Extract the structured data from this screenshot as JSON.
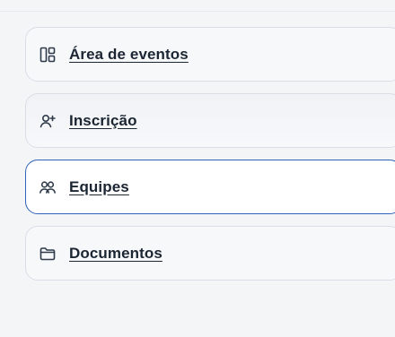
{
  "nav": {
    "items": [
      {
        "label": "Área de eventos",
        "icon": "dashboard-layout-icon"
      },
      {
        "label": "Inscrição",
        "icon": "add-user-icon"
      },
      {
        "label": "Equipes",
        "icon": "team-icon",
        "active": true
      },
      {
        "label": "Documentos",
        "icon": "folder-icon"
      }
    ]
  },
  "colors": {
    "background": "#f4f5f7",
    "item_border": "#d9dee6",
    "active_border": "#2f62b8",
    "text": "#1c2633",
    "icon": "#2f3b4b"
  }
}
